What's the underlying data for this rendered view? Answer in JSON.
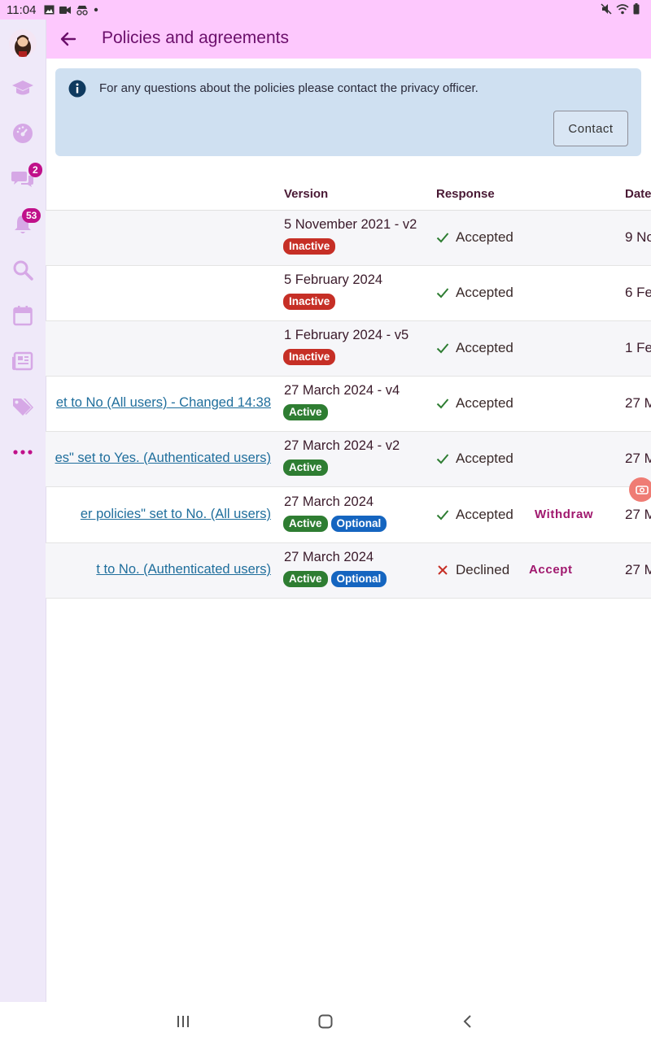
{
  "status": {
    "time": "11:04"
  },
  "header": {
    "title": "Policies and agreements"
  },
  "sidebar": {
    "messages_badge": "2",
    "notifications_badge": "53"
  },
  "info": {
    "message": "For any questions about the policies please contact the privacy officer.",
    "contact_label": "Contact"
  },
  "table": {
    "headers": {
      "version": "Version",
      "response": "Response",
      "date": "Date"
    },
    "rows": [
      {
        "name": "",
        "version": "5 November 2021 - v2",
        "tags": [
          "Inactive"
        ],
        "response": "Accepted",
        "action": "",
        "date": "9 No"
      },
      {
        "name": "",
        "version": "5 February 2024",
        "tags": [
          "Inactive"
        ],
        "response": "Accepted",
        "action": "",
        "date": "6 Fe"
      },
      {
        "name": "",
        "version": "1 February 2024 - v5",
        "tags": [
          "Inactive"
        ],
        "response": "Accepted",
        "action": "",
        "date": "1 Fe"
      },
      {
        "name": "et to No (All users) - Changed 14:38",
        "version": "27 March 2024 - v4",
        "tags": [
          "Active"
        ],
        "response": "Accepted",
        "action": "",
        "date": "27 M"
      },
      {
        "name": "es\" set to Yes. (Authenticated users)",
        "version": "27 March 2024 - v2",
        "tags": [
          "Active"
        ],
        "response": "Accepted",
        "action": "",
        "date": "27 M"
      },
      {
        "name": "er policies\" set to No. (All users)",
        "version": "27 March 2024",
        "tags": [
          "Active",
          "Optional"
        ],
        "response": "Accepted",
        "action": "Withdraw",
        "date": "27 M"
      },
      {
        "name": "t to No. (Authenticated users)",
        "version": "27 March 2024",
        "tags": [
          "Active",
          "Optional"
        ],
        "response": "Declined",
        "action": "Accept",
        "date": "27 M"
      }
    ]
  }
}
